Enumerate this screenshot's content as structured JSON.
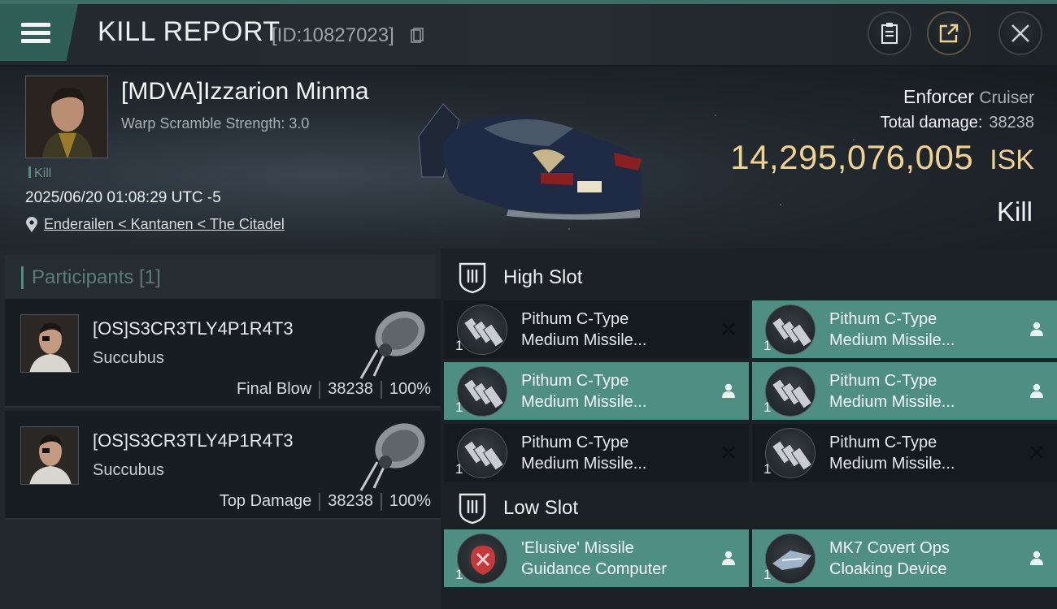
{
  "header": {
    "title": "KILL REPORT",
    "report_id": "[ID:10827023]",
    "icons": [
      "menu-icon",
      "copy-icon",
      "clipboard-icon",
      "share-icon",
      "close-icon"
    ]
  },
  "victim": {
    "name": "[MDVA]Izzarion Minma",
    "scram": "Warp Scramble Strength: 3.0",
    "tag": "Kill",
    "date": "2025/06/20 01:08:29 UTC -5",
    "location": "Enderailen < Kantanen < The Citadel",
    "ship": "Enforcer",
    "ship_class": "Cruiser",
    "damage_label": "Total damage:",
    "damage_value": "38238",
    "isk_amount": "14,295,076,005",
    "isk_currency": "ISK",
    "result": "Kill"
  },
  "participants": {
    "title": "Participants [1]",
    "items": [
      {
        "name": "[OS]S3CR3TLY4P1R4T3",
        "ship": "Succubus",
        "role": "Final Blow",
        "damage": "38238",
        "percent": "100%"
      },
      {
        "name": "[OS]S3CR3TLY4P1R4T3",
        "ship": "Succubus",
        "role": "Top Damage",
        "damage": "38238",
        "percent": "100%"
      }
    ]
  },
  "fitting": {
    "high_slot_title": "High Slot",
    "low_slot_title": "Low Slot",
    "high": [
      {
        "line1": "Pithum C-Type",
        "line2": "Medium Missile...",
        "qty": "1",
        "status": "destroyed"
      },
      {
        "line1": "Pithum C-Type",
        "line2": "Medium Missile...",
        "qty": "1",
        "status": "dropped"
      },
      {
        "line1": "Pithum C-Type",
        "line2": "Medium Missile...",
        "qty": "1",
        "status": "dropped"
      },
      {
        "line1": "Pithum C-Type",
        "line2": "Medium Missile...",
        "qty": "1",
        "status": "dropped"
      },
      {
        "line1": "Pithum C-Type",
        "line2": "Medium Missile...",
        "qty": "1",
        "status": "destroyed"
      },
      {
        "line1": "Pithum C-Type",
        "line2": "Medium Missile...",
        "qty": "1",
        "status": "destroyed"
      }
    ],
    "low": [
      {
        "line1": "'Elusive' Missile",
        "line2": "Guidance Computer",
        "qty": "1",
        "status": "dropped"
      },
      {
        "line1": "MK7 Covert Ops",
        "line2": "Cloaking Device",
        "qty": "1",
        "status": "dropped"
      }
    ]
  },
  "colors": {
    "accent": "#4f8f83",
    "isk": "#f1d291",
    "header_topline": "#3f6e66"
  }
}
